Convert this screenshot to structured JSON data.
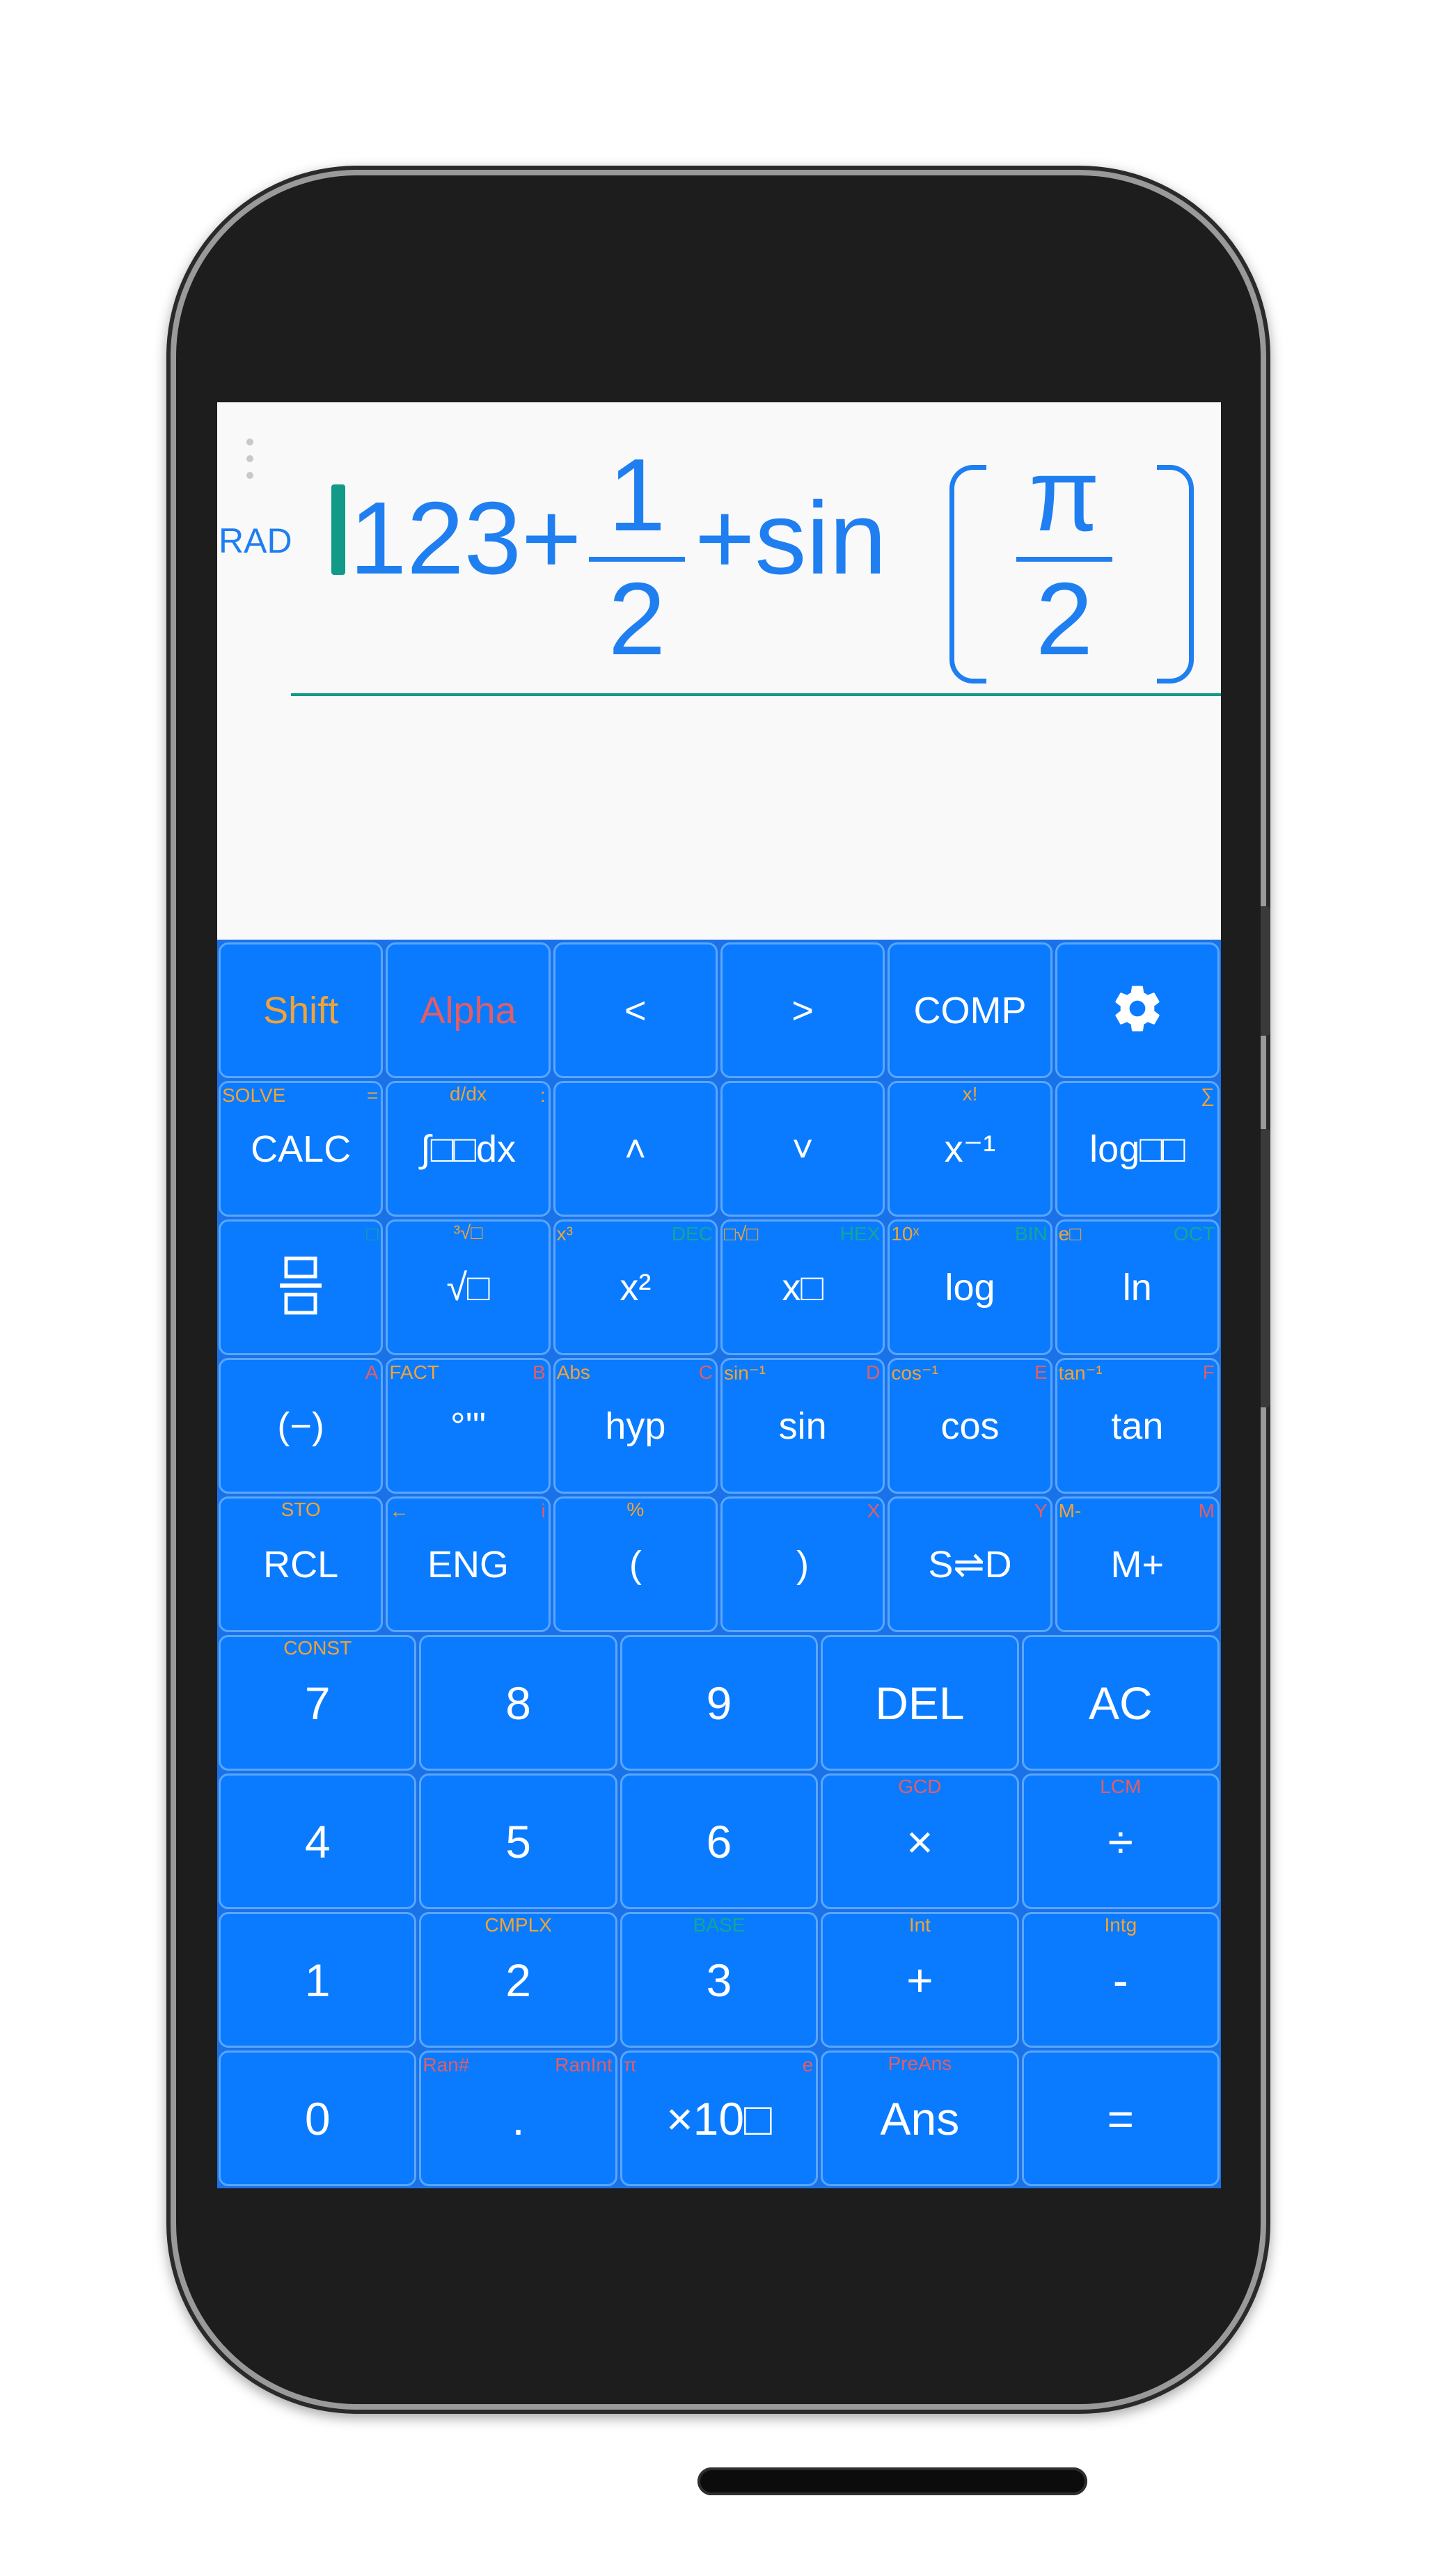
{
  "display": {
    "angle_mode": "RAD",
    "expression": {
      "integer": "123+",
      "frac1": {
        "num": "1",
        "den": "2"
      },
      "func": "+sin",
      "frac2": {
        "num": "π",
        "den": "2"
      }
    }
  },
  "keypad": {
    "rows": [
      [
        {
          "label": "Shift",
          "name": "shift-key",
          "color": "orange"
        },
        {
          "label": "Alpha",
          "name": "alpha-key",
          "color": "red"
        },
        {
          "label": "<",
          "name": "cursor-left-key"
        },
        {
          "label": ">",
          "name": "cursor-right-key"
        },
        {
          "label": "COMP",
          "name": "mode-comp-key"
        },
        {
          "label": "",
          "name": "settings-key",
          "icon": "gear-icon"
        }
      ],
      [
        {
          "label": "CALC",
          "name": "calc-key",
          "top_left": "SOLVE",
          "top_right": "="
        },
        {
          "label": "∫□□dx",
          "name": "integral-key",
          "top_center": "d/dx",
          "top_right": ":"
        },
        {
          "label": "˄",
          "name": "cursor-up-key"
        },
        {
          "label": "˅",
          "name": "cursor-down-key"
        },
        {
          "label": "x⁻¹",
          "name": "inverse-key",
          "top_center": "x!"
        },
        {
          "label": "log□□",
          "name": "log-base-key",
          "top_right": "∑"
        }
      ],
      [
        {
          "label": "",
          "name": "fraction-key",
          "icon": "fraction-icon",
          "top_right": "□"
        },
        {
          "label": "√□",
          "name": "sqrt-key",
          "top_center": "³√□"
        },
        {
          "label": "x²",
          "name": "square-key",
          "top_left": "x³",
          "top_right": "DEC"
        },
        {
          "label": "x□",
          "name": "power-key",
          "top_left": "□√□",
          "top_right": "HEX"
        },
        {
          "label": "log",
          "name": "log-key",
          "top_left": "10ˣ",
          "top_right": "BIN"
        },
        {
          "label": "ln",
          "name": "ln-key",
          "top_left": "e□",
          "top_right": "OCT"
        }
      ],
      [
        {
          "label": "(−)",
          "name": "negative-key",
          "top_right": "A"
        },
        {
          "label": "°'\"",
          "name": "degree-key",
          "top_left": "FACT",
          "top_right": "B"
        },
        {
          "label": "hyp",
          "name": "hyp-key",
          "top_left": "Abs",
          "top_right": "C"
        },
        {
          "label": "sin",
          "name": "sin-key",
          "top_left": "sin⁻¹",
          "top_right": "D"
        },
        {
          "label": "cos",
          "name": "cos-key",
          "top_left": "cos⁻¹",
          "top_right": "E"
        },
        {
          "label": "tan",
          "name": "tan-key",
          "top_left": "tan⁻¹",
          "top_right": "F"
        }
      ],
      [
        {
          "label": "RCL",
          "name": "rcl-key",
          "top_center": "STO"
        },
        {
          "label": "ENG",
          "name": "eng-key",
          "top_left": "←",
          "top_right": "i"
        },
        {
          "label": "(",
          "name": "open-paren-key",
          "top_center": "%"
        },
        {
          "label": ")",
          "name": "close-paren-key",
          "top_right": "X"
        },
        {
          "label": "S⇌D",
          "name": "s-d-key",
          "top_right": "Y"
        },
        {
          "label": "M+",
          "name": "m-plus-key",
          "top_left": "M-",
          "top_right": "M"
        }
      ],
      [
        {
          "label": "7",
          "name": "digit-7-key",
          "top_center": "CONST"
        },
        {
          "label": "8",
          "name": "digit-8-key"
        },
        {
          "label": "9",
          "name": "digit-9-key"
        },
        {
          "label": "DEL",
          "name": "delete-key"
        },
        {
          "label": "AC",
          "name": "all-clear-key"
        }
      ],
      [
        {
          "label": "4",
          "name": "digit-4-key"
        },
        {
          "label": "5",
          "name": "digit-5-key"
        },
        {
          "label": "6",
          "name": "digit-6-key"
        },
        {
          "label": "×",
          "name": "multiply-key",
          "top_center": "GCD"
        },
        {
          "label": "÷",
          "name": "divide-key",
          "top_center": "LCM"
        }
      ],
      [
        {
          "label": "1",
          "name": "digit-1-key"
        },
        {
          "label": "2",
          "name": "digit-2-key",
          "top_center": "CMPLX"
        },
        {
          "label": "3",
          "name": "digit-3-key",
          "top_center": "BASE"
        },
        {
          "label": "+",
          "name": "plus-key",
          "top_center": "Int"
        },
        {
          "label": "-",
          "name": "minus-key",
          "top_center": "Intg"
        }
      ],
      [
        {
          "label": "0",
          "name": "digit-0-key"
        },
        {
          "label": ".",
          "name": "decimal-key",
          "top_left": "Ran#",
          "top_right": "RanInt"
        },
        {
          "label": "×10□",
          "name": "exp10-key",
          "top_left": "π",
          "top_right": "e"
        },
        {
          "label": "Ans",
          "name": "ans-key",
          "top_center": "PreAns"
        },
        {
          "label": "=",
          "name": "equals-key"
        }
      ]
    ]
  },
  "colors": {
    "accent": "#1f7ff0",
    "key": "#0a7bfe",
    "cursor": "#119a88"
  }
}
